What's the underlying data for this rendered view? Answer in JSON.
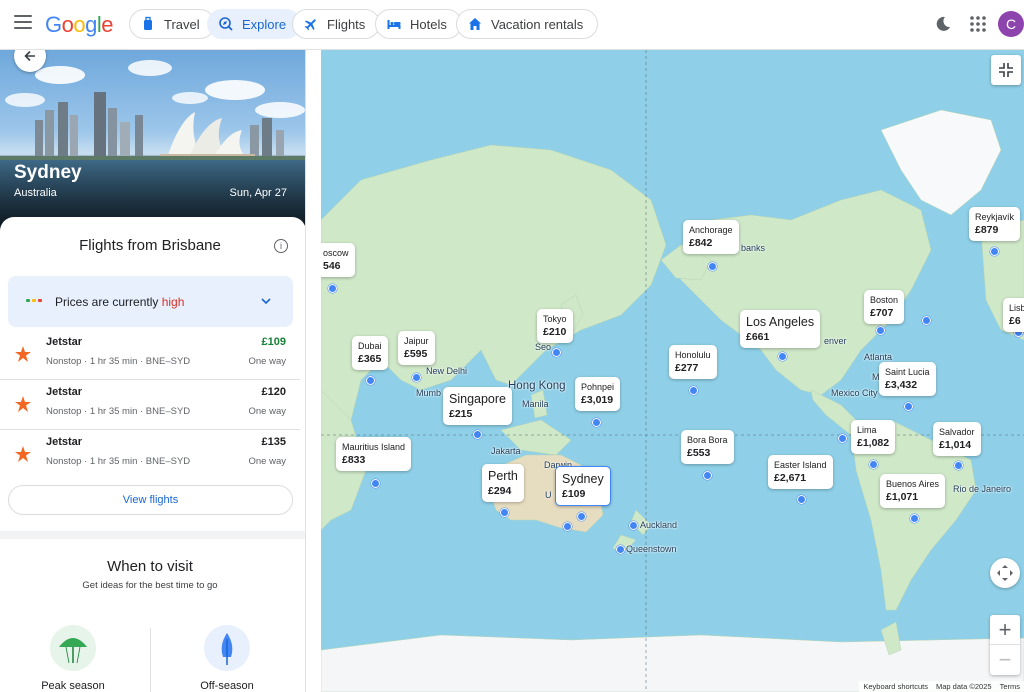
{
  "header": {
    "logo": [
      "G",
      "o",
      "o",
      "g",
      "l",
      "e"
    ],
    "tabs": [
      {
        "label": "Travel",
        "icon": "travel-bag-icon"
      },
      {
        "label": "Explore",
        "icon": "explore-icon"
      },
      {
        "label": "Flights",
        "icon": "plane-icon"
      },
      {
        "label": "Hotels",
        "icon": "bed-icon"
      },
      {
        "label": "Vacation rentals",
        "icon": "house-icon"
      }
    ],
    "avatar_letter": "C"
  },
  "destination": {
    "city": "Sydney",
    "country": "Australia",
    "date": "Sun, Apr 27"
  },
  "flights": {
    "title": "Flights from Brisbane",
    "price_note_prefix": "Prices are currently ",
    "price_note_level": "high",
    "rows": [
      {
        "airline": "Jetstar",
        "details": "Nonstop · 1 hr 35 min · BNE–SYD",
        "price": "£109",
        "type": "One way"
      },
      {
        "airline": "Jetstar",
        "details": "Nonstop · 1 hr 35 min · BNE–SYD",
        "price": "£120",
        "type": "One way"
      },
      {
        "airline": "Jetstar",
        "details": "Nonstop · 1 hr 35 min · BNE–SYD",
        "price": "£135",
        "type": "One way"
      }
    ],
    "view_button": "View flights"
  },
  "when": {
    "title": "When to visit",
    "subtitle": "Get ideas for the best time to go",
    "peak": "Peak season",
    "off": "Off-season"
  },
  "map": {
    "pins": [
      {
        "name": "oscow",
        "price": "546"
      },
      {
        "name": "Anchorage",
        "price": "£842"
      },
      {
        "name": "Reykjavík",
        "price": "£879"
      },
      {
        "name": "Tokyo",
        "price": "£210"
      },
      {
        "name": "Dubai",
        "price": "£365"
      },
      {
        "name": "Jaipur",
        "price": "£595"
      },
      {
        "name": "Boston",
        "price": "£707"
      },
      {
        "name": "Los Angeles",
        "price": "£661"
      },
      {
        "name": "Honolulu",
        "price": "£277"
      },
      {
        "name": "Saint Lucia",
        "price": "£3,432"
      },
      {
        "name": "Singapore",
        "price": "£215"
      },
      {
        "name": "Pohnpei",
        "price": "£3,019"
      },
      {
        "name": "Mauritius Island",
        "price": "£833"
      },
      {
        "name": "Bora Bora",
        "price": "£553"
      },
      {
        "name": "Lima",
        "price": "£1,082"
      },
      {
        "name": "Salvador",
        "price": "£1,014"
      },
      {
        "name": "Easter Island",
        "price": "£2,671"
      },
      {
        "name": "Perth",
        "price": "£294"
      },
      {
        "name": "Sydney",
        "price": "£109"
      },
      {
        "name": "Buenos Aires",
        "price": "£1,071"
      },
      {
        "name": "Lisb",
        "price": "£6"
      }
    ],
    "labels": [
      "banks",
      "enver",
      "Atlanta",
      "M",
      "Mexico City",
      "Seo",
      "New Delhi",
      "Mumb",
      "Hong Kong",
      "Manila",
      "Jakarta",
      "Darwin",
      "U",
      "Auckland",
      "Queenstown",
      "Rio de Janeiro"
    ],
    "attribution": [
      "Keyboard shortcuts",
      "Map data ©2025",
      "Terms"
    ]
  }
}
